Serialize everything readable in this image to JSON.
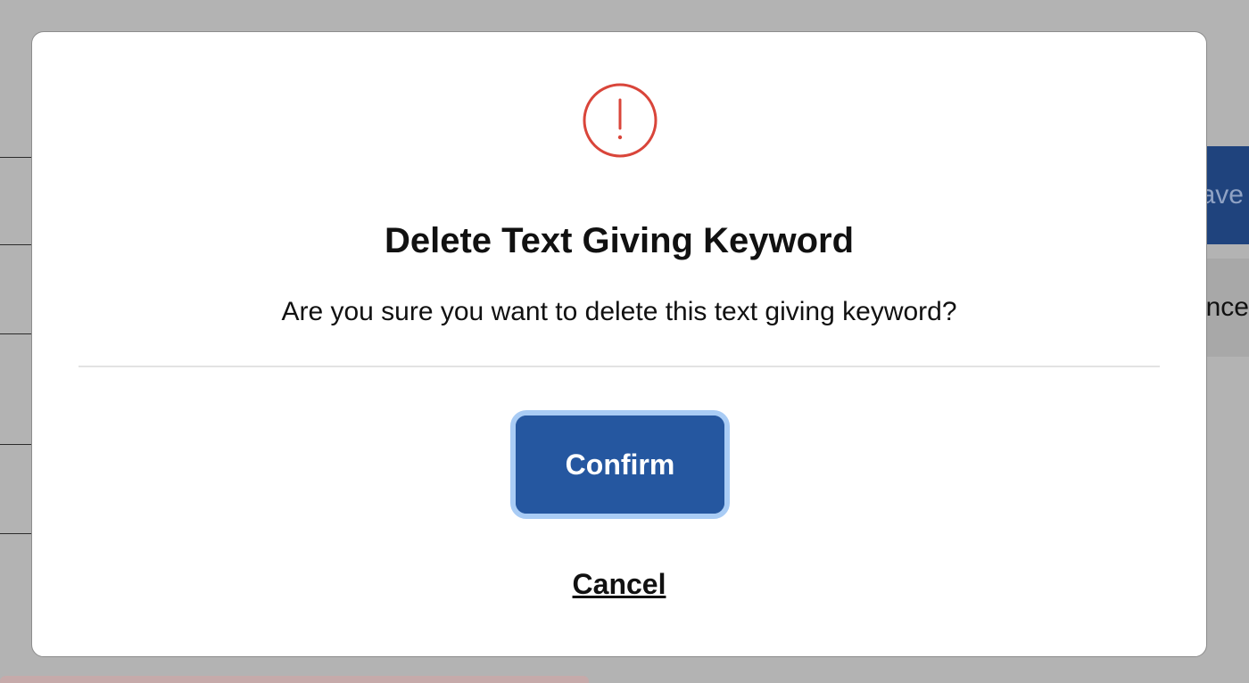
{
  "background": {
    "save_button_label": "ave",
    "cancel_button_label": "nce"
  },
  "modal": {
    "icon": "alert-circle-icon",
    "icon_color": "#d9453a",
    "title": "Delete Text Giving Keyword",
    "message": "Are you sure you want to delete this text giving keyword?",
    "confirm_label": "Confirm",
    "cancel_label": "Cancel",
    "accent_color": "#2557a0"
  }
}
